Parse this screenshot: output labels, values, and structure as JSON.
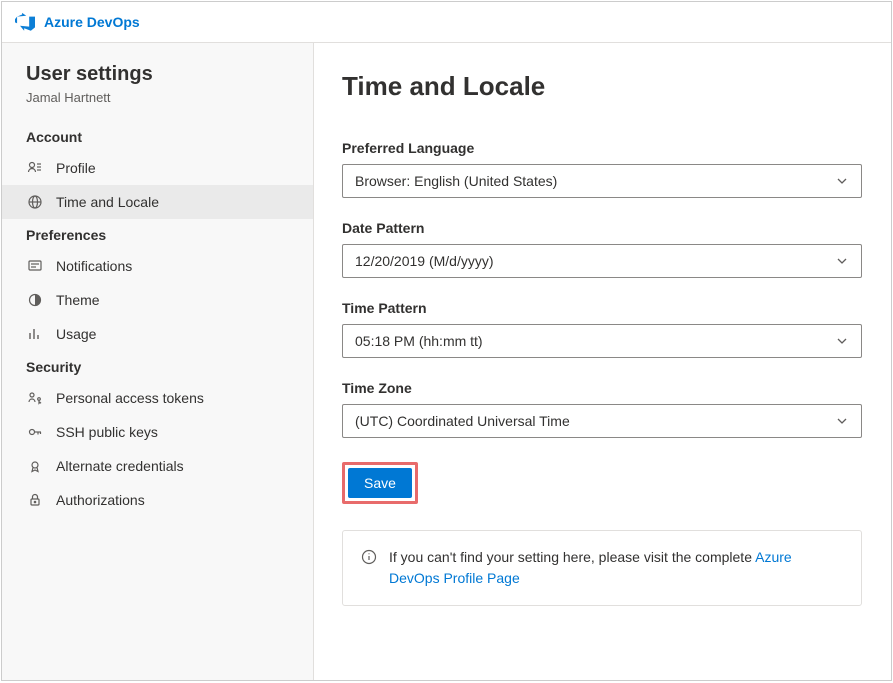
{
  "brand": "Azure DevOps",
  "sidebar": {
    "title": "User settings",
    "username": "Jamal Hartnett",
    "sections": [
      {
        "label": "Account",
        "items": [
          {
            "id": "profile",
            "label": "Profile",
            "icon": "profile-icon",
            "active": false
          },
          {
            "id": "time-and-locale",
            "label": "Time and Locale",
            "icon": "globe-icon",
            "active": true
          }
        ]
      },
      {
        "label": "Preferences",
        "items": [
          {
            "id": "notifications",
            "label": "Notifications",
            "icon": "notification-icon",
            "active": false
          },
          {
            "id": "theme",
            "label": "Theme",
            "icon": "theme-icon",
            "active": false
          },
          {
            "id": "usage",
            "label": "Usage",
            "icon": "usage-icon",
            "active": false
          }
        ]
      },
      {
        "label": "Security",
        "items": [
          {
            "id": "personal-access-tokens",
            "label": "Personal access tokens",
            "icon": "key-person-icon",
            "active": false
          },
          {
            "id": "ssh-public-keys",
            "label": "SSH public keys",
            "icon": "key-icon",
            "active": false
          },
          {
            "id": "alternate-credentials",
            "label": "Alternate credentials",
            "icon": "credentials-icon",
            "active": false
          },
          {
            "id": "authorizations",
            "label": "Authorizations",
            "icon": "lock-icon",
            "active": false
          }
        ]
      }
    ]
  },
  "main": {
    "title": "Time and Locale",
    "fields": {
      "preferred_language": {
        "label": "Preferred Language",
        "value": "Browser: English (United States)"
      },
      "date_pattern": {
        "label": "Date Pattern",
        "value": "12/20/2019 (M/d/yyyy)"
      },
      "time_pattern": {
        "label": "Time Pattern",
        "value": "05:18 PM (hh:mm tt)"
      },
      "time_zone": {
        "label": "Time Zone",
        "value": "(UTC) Coordinated Universal Time"
      }
    },
    "save_label": "Save",
    "info": {
      "text_prefix": "If you can't find your setting here, please visit the complete ",
      "link_text": "Azure DevOps Profile Page"
    }
  }
}
